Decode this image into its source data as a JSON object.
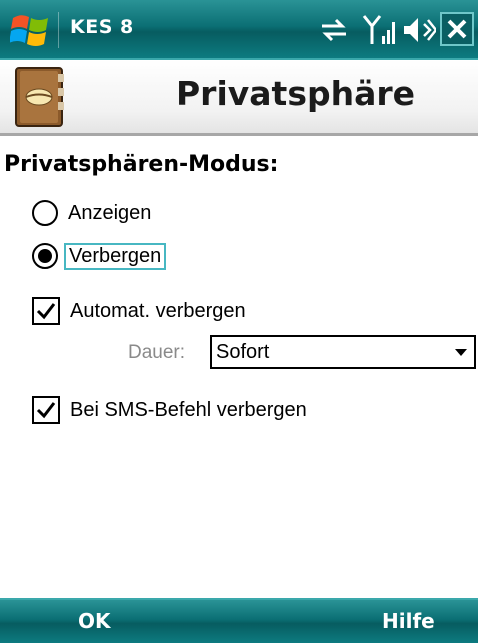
{
  "status_bar": {
    "app_name": "KES 8",
    "icons": [
      "windows-start-icon",
      "sync-icon",
      "signal-icon",
      "volume-icon",
      "close-icon"
    ]
  },
  "title_bar": {
    "title": "Privatsphäre",
    "icon": "address-book-icon"
  },
  "privacy_mode": {
    "heading": "Privatsphären-Modus:",
    "options": [
      {
        "label": "Anzeigen",
        "selected": false
      },
      {
        "label": "Verbergen",
        "selected": true
      }
    ]
  },
  "auto_hide": {
    "label": "Automat. verbergen",
    "checked": true,
    "duration_label": "Dauer:",
    "duration_value": "Sofort"
  },
  "sms_hide": {
    "label": "Bei SMS-Befehl verbergen",
    "checked": true
  },
  "softkeys": {
    "left": "OK",
    "right": "Hilfe"
  },
  "colors": {
    "bar_teal": "#0b6f74",
    "focus_border": "#47b7c2"
  }
}
